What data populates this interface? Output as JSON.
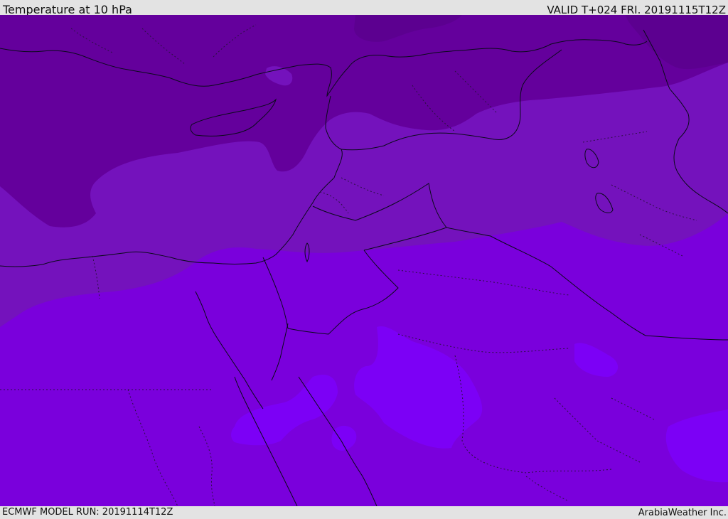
{
  "header": {
    "title": "Temperature at 10 hPa",
    "valid": "VALID T+024 FRI. 20191115T12Z"
  },
  "footer": {
    "model_run": "ECMWF MODEL RUN: 20191114T12Z",
    "brand": "ArabiaWeather Inc."
  },
  "colors": {
    "coldest": "#5c0090",
    "cold": "#64009c",
    "mid": "#7412bc",
    "warm": "#7a00dc",
    "warmest": "#7c00f6",
    "coastline": "#0a0a1a",
    "border": "#0a0a1a"
  }
}
